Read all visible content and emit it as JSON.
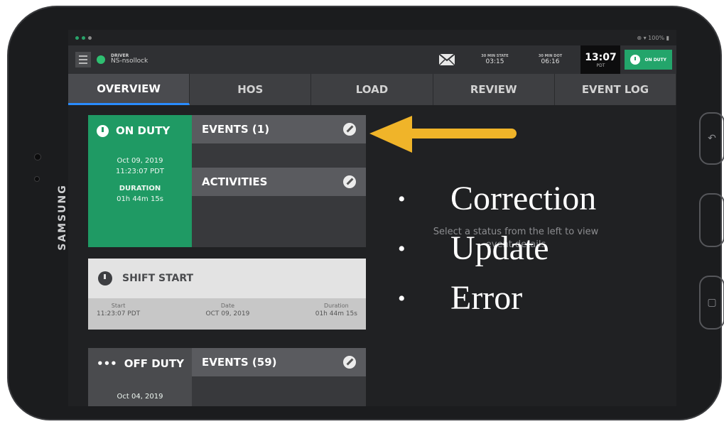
{
  "device": {
    "brand": "SAMSUNG"
  },
  "statusbar": {
    "right": "⊕ ▾ 100% ▮"
  },
  "topbar": {
    "driver_label": "DRIVER",
    "driver_value": "NS-nsollock",
    "stats": [
      {
        "label": "30 MIN STATE",
        "value": "03:15"
      },
      {
        "label": "30 MIN DOT",
        "value": "06:16"
      }
    ],
    "clock_time": "13:07",
    "clock_zone": "PDT",
    "duty_button": "ON DUTY"
  },
  "tabs": [
    "OVERVIEW",
    "HOS",
    "LOAD",
    "REVIEW",
    "EVENT LOG"
  ],
  "on_duty_card": {
    "status": "ON DUTY",
    "date": "Oct 09, 2019",
    "time": "11:23:07 PDT",
    "duration_label": "DURATION",
    "duration": "01h 44m 15s",
    "events_label": "EVENTS (1)",
    "activities_label": "ACTIVITIES"
  },
  "shift_card": {
    "title": "SHIFT START",
    "start_label": "Start",
    "start_value": "11:23:07 PDT",
    "date_label": "Date",
    "date_value": "OCT 09, 2019",
    "duration_label": "Duration",
    "duration_value": "01h 44m 15s"
  },
  "off_duty_card": {
    "status": "OFF DUTY",
    "date": "Oct 04, 2019",
    "events_label": "EVENTS (59)"
  },
  "placeholder_text": "Select a status from the left to view event details",
  "annotation": {
    "arrow_color": "#f0b429",
    "bullets": [
      "Correction",
      "Update",
      "Error"
    ]
  },
  "colors": {
    "on_duty_green": "#1f9a64",
    "accent": "#2fbf71"
  }
}
